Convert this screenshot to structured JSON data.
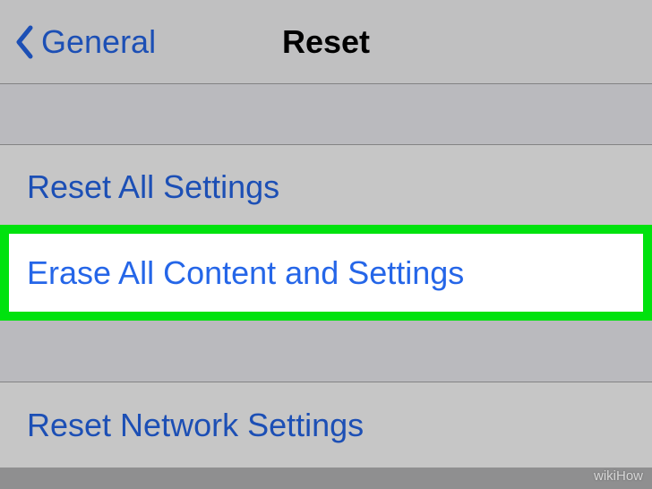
{
  "navbar": {
    "back_label": "General",
    "title": "Reset"
  },
  "rows": {
    "reset_all": "Reset All Settings",
    "erase_all": "Erase All Content and Settings",
    "reset_network": "Reset Network Settings"
  },
  "watermark": "wikiHow"
}
